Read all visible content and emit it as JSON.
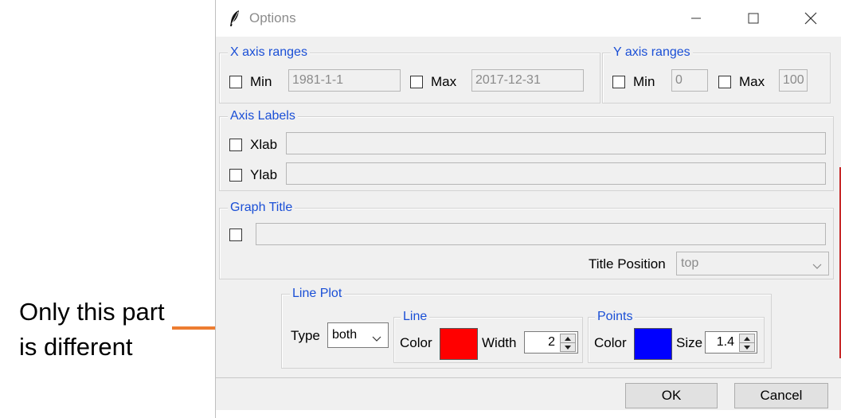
{
  "annotation": {
    "line1": "Only this part",
    "line2": "is different",
    "color": "#ed7d31"
  },
  "window": {
    "title": "Options",
    "icon": "feather-icon"
  },
  "x_axis": {
    "legend": "X axis ranges",
    "min_label": "Min",
    "min_value": "1981-1-1",
    "max_label": "Max",
    "max_value": "2017-12-31"
  },
  "y_axis": {
    "legend": "Y axis ranges",
    "min_label": "Min",
    "min_value": "0",
    "max_label": "Max",
    "max_value": "100"
  },
  "axis_labels": {
    "legend": "Axis Labels",
    "xlab_label": "Xlab",
    "xlab_value": "",
    "ylab_label": "Ylab",
    "ylab_value": ""
  },
  "graph_title": {
    "legend": "Graph Title",
    "value": "",
    "position_label": "Title Position",
    "position_value": "top"
  },
  "line_plot": {
    "legend": "Line Plot",
    "type_label": "Type",
    "type_value": "both",
    "line": {
      "legend": "Line",
      "color_label": "Color",
      "color": "#ff0000",
      "width_label": "Width",
      "width_value": "2"
    },
    "points": {
      "legend": "Points",
      "color_label": "Color",
      "color": "#0000ff",
      "size_label": "Size",
      "size_value": "1.4"
    }
  },
  "buttons": {
    "ok": "OK",
    "cancel": "Cancel"
  }
}
